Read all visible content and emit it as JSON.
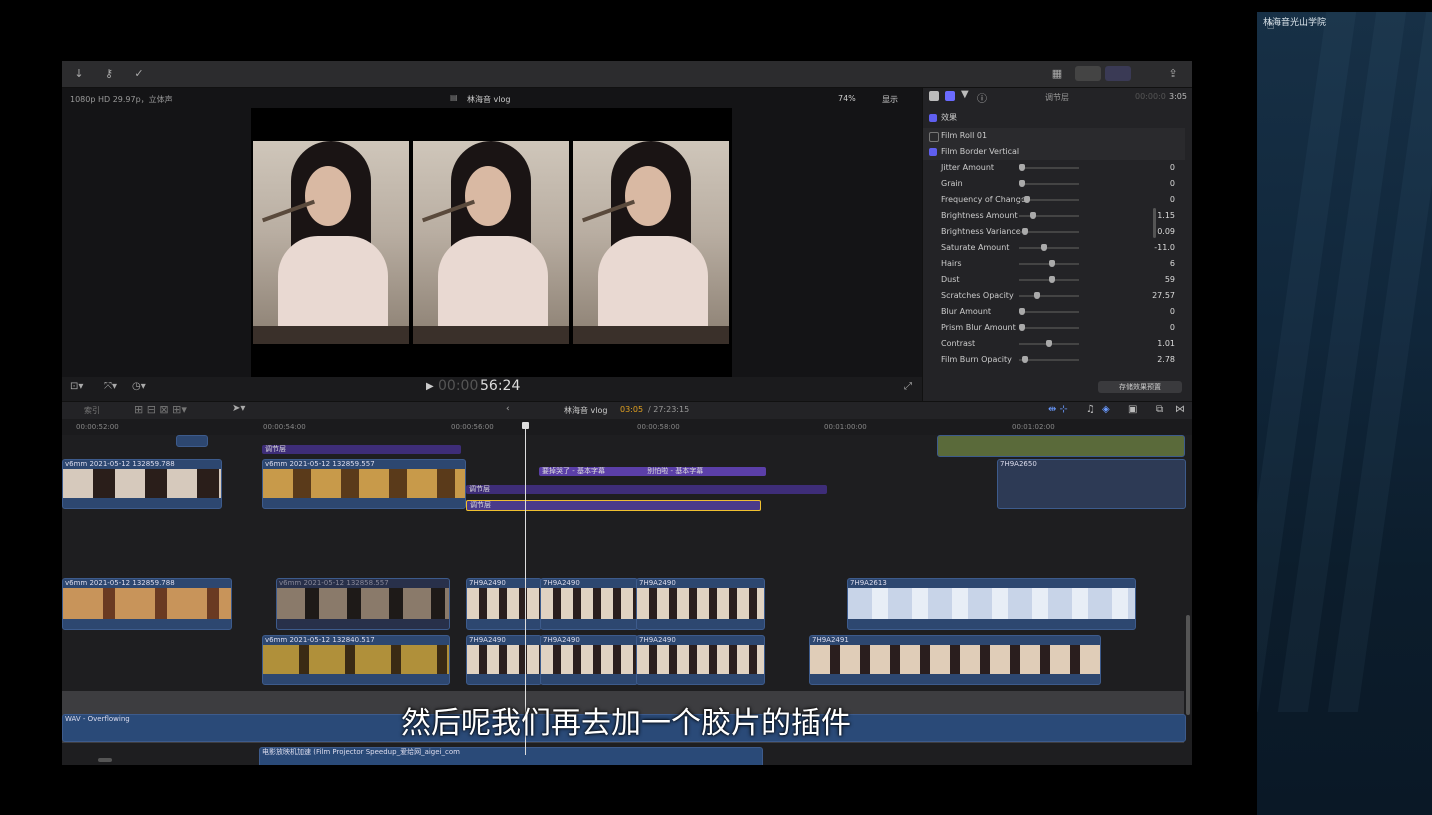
{
  "side_panel": {
    "title": "林海音光山学院"
  },
  "toolbar": {
    "icons": [
      "download-icon",
      "key-icon",
      "check-circle-icon",
      "grid-icon",
      "filmstrip-icon",
      "inspector-icon",
      "share-icon"
    ]
  },
  "viewer": {
    "format": "1080p HD 29.97p，立体声",
    "project_name": "林海音 vlog",
    "zoom": "74%",
    "display_menu": "显示",
    "timecode_dim": "00:00",
    "timecode": "56:24"
  },
  "inspector": {
    "tab_title": "调节层",
    "duration_dim": "00:00:0",
    "duration": "3:05",
    "effects_label": "效果",
    "effects": [
      {
        "name": "Film Roll 01",
        "checked": false
      },
      {
        "name": "Film Border Vertical",
        "checked": true
      }
    ],
    "params": [
      {
        "label": "Jitter Amount",
        "value": "0",
        "level": 0.0
      },
      {
        "label": "Grain",
        "value": "0",
        "level": 0.0
      },
      {
        "label": "Frequency of Change",
        "value": "0",
        "level": 0.1
      },
      {
        "label": "Brightness Amount",
        "value": "1.15",
        "level": 0.2
      },
      {
        "label": "Brightness Variance",
        "value": "0.09",
        "level": 0.05
      },
      {
        "label": "Saturate Amount",
        "value": "-11.0",
        "level": 0.4
      },
      {
        "label": "Hairs",
        "value": "6",
        "level": 0.55
      },
      {
        "label": "Dust",
        "value": "59",
        "level": 0.55
      },
      {
        "label": "Scratches Opacity",
        "value": "27.57",
        "level": 0.28
      },
      {
        "label": "Blur Amount",
        "value": "0",
        "level": 0.0
      },
      {
        "label": "Prism Blur Amount",
        "value": "0",
        "level": 0.0
      },
      {
        "label": "Contrast",
        "value": "1.01",
        "level": 0.5
      },
      {
        "label": "Film Burn Opacity",
        "value": "2.78",
        "level": 0.05
      }
    ],
    "save_preset": "存储效果预置"
  },
  "timeline": {
    "index_label": "索引",
    "project_name": "林海音 vlog",
    "position": "03:05",
    "total": "/ 27:23:15",
    "ruler": [
      "00:00:52:00",
      "00:00:54:00",
      "00:00:56:00",
      "00:00:58:00",
      "00:01:00:00",
      "00:01:02:00"
    ],
    "clips": {
      "adjust_top": "调节层",
      "v6mm_a": "v6mm 2021-05-12 132859.788",
      "v6mm_b": "v6mm 2021-05-12 132859.557",
      "title1": "要掉哭了 - 基本字幕",
      "title2": "别怕啦 - 基本字幕",
      "adjust_mid": "调节层",
      "adjust_sel": "调节层",
      "v6mm_c": "v6mm 2021-05-12 132859.788",
      "v6mm_d": "v6mm 2021-05-12 132858.557",
      "h2490_1": "7H9A2490",
      "h2490_2": "7H9A2490",
      "h2490_3": "7H9A2490",
      "h2613": "7H9A2613",
      "v6mm_e": "v6mm 2021-05-12 132840.517",
      "h2490_4": "7H9A2490",
      "h2490_5": "7H9A2490",
      "h2490_6": "7H9A2490",
      "h2491": "7H9A2491",
      "h2650": "7H9A2650",
      "audio_sfx": "电影放映机加速 (Film Projector Speedup_爱给网_aigei_com",
      "audio_music": "WAV - Overflowing"
    }
  },
  "subtitle": "然后呢我们再去加一个胶片的插件"
}
